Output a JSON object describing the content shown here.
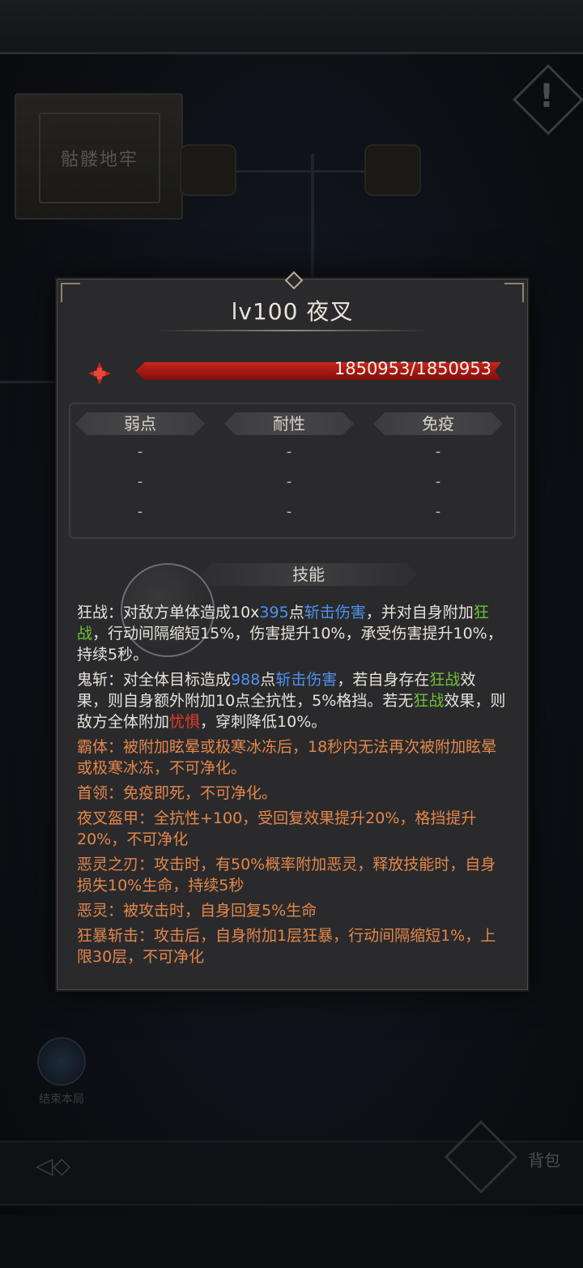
{
  "background": {
    "dungeon_sign": "骷髅地牢",
    "alert_mark": "!",
    "end_round_label": "结束本局",
    "bag_label": "背包"
  },
  "panel": {
    "title": "lv100  夜叉",
    "hp_text": "1850953/1850953",
    "hp_fill_fraction": 1.0,
    "attr_headers": [
      "弱点",
      "耐性",
      "免疫"
    ],
    "attr_rows": [
      [
        "-",
        "-",
        "-"
      ],
      [
        "-",
        "-",
        "-"
      ],
      [
        "-",
        "-",
        "-"
      ]
    ],
    "skills_header": "技能",
    "skills": [
      {
        "parts": [
          {
            "t": "狂战：对敌方单体造成10x",
            "c": "w"
          },
          {
            "t": "395",
            "c": "b"
          },
          {
            "t": "点",
            "c": "w"
          },
          {
            "t": "斩击伤害",
            "c": "b"
          },
          {
            "t": "，并对自身附加",
            "c": "w"
          },
          {
            "t": "狂战",
            "c": "g"
          },
          {
            "t": "，行动间隔缩短15%，伤害提升10%，承受伤害提升10%，持续5秒。",
            "c": "w"
          }
        ]
      },
      {
        "parts": [
          {
            "t": "鬼斩：对全体目标造成",
            "c": "w"
          },
          {
            "t": "988",
            "c": "b"
          },
          {
            "t": "点",
            "c": "w"
          },
          {
            "t": "斩击伤害",
            "c": "b"
          },
          {
            "t": "，若自身存在",
            "c": "w"
          },
          {
            "t": "狂战",
            "c": "g"
          },
          {
            "t": "效果，则自身额外附加10点全抗性，5%格挡。若无",
            "c": "w"
          },
          {
            "t": "狂战",
            "c": "g"
          },
          {
            "t": "效果，则敌方全体附加",
            "c": "w"
          },
          {
            "t": "忧惧",
            "c": "r"
          },
          {
            "t": "，穿刺降低10%。",
            "c": "w"
          }
        ]
      },
      {
        "parts": [
          {
            "t": "霸体：被附加眩晕或极寒冰冻后，18秒内无法再次被附加眩晕或极寒冰冻，不可净化。",
            "c": "o"
          }
        ]
      },
      {
        "parts": [
          {
            "t": "首领：免疫即死，不可净化。",
            "c": "o"
          }
        ]
      },
      {
        "parts": [
          {
            "t": "夜叉盔甲：全抗性+100，受回复效果提升20%，格挡提升20%，不可净化",
            "c": "o"
          }
        ]
      },
      {
        "parts": [
          {
            "t": "恶灵之刃：攻击时，有50%概率附加恶灵，释放技能时，自身损失10%生命，持续5秒",
            "c": "o"
          }
        ]
      },
      {
        "parts": [
          {
            "t": "恶灵：被攻击时，自身回复5%生命",
            "c": "o"
          }
        ]
      },
      {
        "parts": [
          {
            "t": "狂暴斩击：攻击后，自身附加1层狂暴，行动间隔缩短1%，上限30层，不可净化",
            "c": "o"
          }
        ]
      }
    ]
  },
  "colors": {
    "hp_bar": "#b01c15",
    "highlight_blue": "#4f92ee",
    "highlight_green": "#6fbf3c",
    "highlight_red": "#e23a2f",
    "passive_orange": "#e3874b",
    "panel_bg": "#2a2a2c"
  }
}
